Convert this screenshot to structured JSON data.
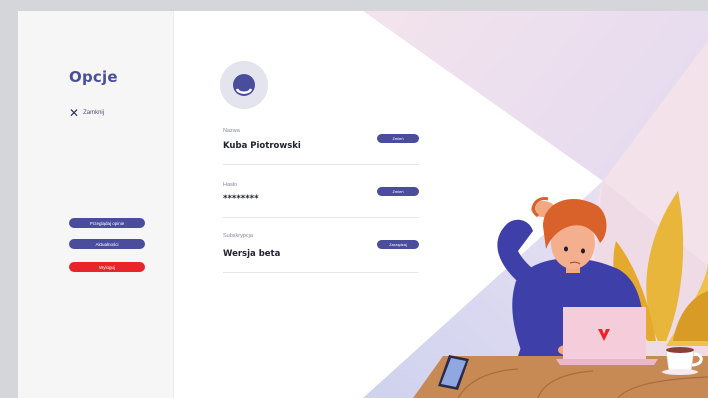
{
  "sidebar": {
    "title": "Opcje",
    "close_label": "Zamknij",
    "buttons": [
      "Przeglądaj opinie",
      "Aktualności",
      "Wyloguj"
    ]
  },
  "profile": {
    "fields": [
      {
        "label": "Nazwa",
        "value": "Kuba Piotrowski",
        "action": "Zmień"
      },
      {
        "label": "Hasło",
        "value": "********",
        "action": "Zmień"
      },
      {
        "label": "Subskrypcja",
        "value": "Wersja beta",
        "action": "Zarządzaj"
      }
    ]
  },
  "colors": {
    "accent": "#4a4c9c",
    "danger": "#e8262a",
    "title": "#4b4e9a"
  },
  "icons": [
    "close-icon",
    "avatar-icon",
    "laptop-logo-icon"
  ]
}
